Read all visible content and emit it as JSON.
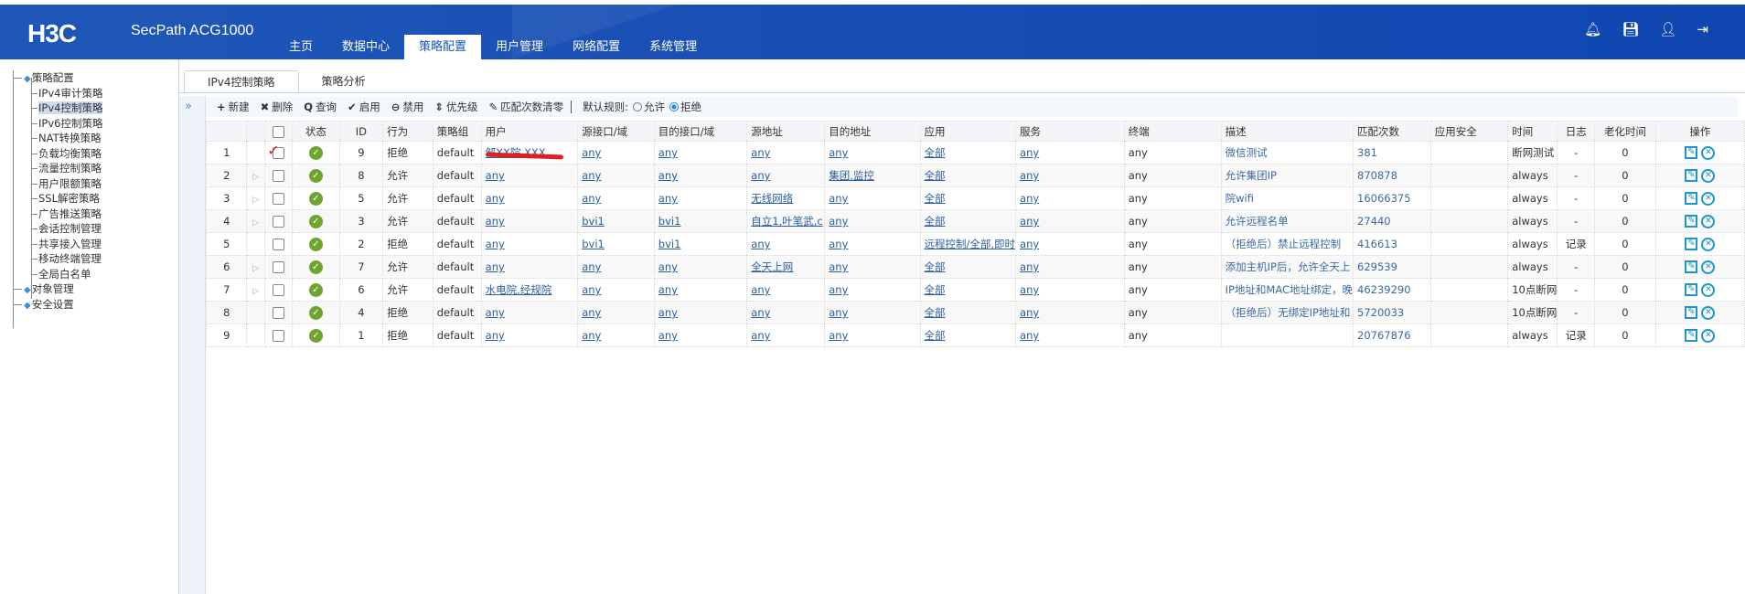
{
  "header": {
    "logo": "H3C",
    "product": "SecPath ACG1000",
    "nav": [
      "主页",
      "数据中心",
      "策略配置",
      "用户管理",
      "网络配置",
      "系统管理"
    ],
    "active_nav": 2,
    "icons": [
      "bell-icon",
      "save-icon",
      "user-icon",
      "logout-icon"
    ]
  },
  "sidebar": {
    "root": "策略配置",
    "items": [
      "IPv4审计策略",
      "IPv4控制策略",
      "IPv6控制策略",
      "NAT转换策略",
      "负载均衡策略",
      "流量控制策略",
      "用户限额策略",
      "SSL解密策略",
      "广告推送策略",
      "会话控制管理",
      "共享接入管理",
      "移动终端管理",
      "全局白名单"
    ],
    "selected": 1,
    "others": [
      "对象管理",
      "安全设置"
    ]
  },
  "tabs": [
    "IPv4控制策略",
    "策略分析"
  ],
  "toolbar": {
    "new": "新建",
    "delete": "删除",
    "query": "查询",
    "enable": "启用",
    "disable": "禁用",
    "priority": "优先级",
    "clear": "匹配次数清零",
    "default_rule_label": "默认规则:",
    "allow": "允许",
    "deny": "拒绝",
    "default_rule": "拒绝"
  },
  "table": {
    "headers": [
      "状态",
      "ID",
      "行为",
      "策略组",
      "用户",
      "源接口/域",
      "目的接口/域",
      "源地址",
      "目的地址",
      "应用",
      "服务",
      "终端",
      "描述",
      "匹配次数",
      "应用安全",
      "时间",
      "日志",
      "老化时间",
      "操作"
    ],
    "rows": [
      {
        "n": "1",
        "exp": false,
        "id": "9",
        "act": "拒绝",
        "grp": "default",
        "user": "邹XX院,XXX",
        "src_if": "any",
        "dst_if": "any",
        "src": "any",
        "dst": "any",
        "app": "全部",
        "svc": "any",
        "term": "any",
        "desc": "微信测试",
        "count": "381",
        "sec": "",
        "time": "断网测试",
        "log": "-",
        "age": "0"
      },
      {
        "n": "2",
        "exp": true,
        "id": "8",
        "act": "允许",
        "grp": "default",
        "user": "any",
        "src_if": "any",
        "dst_if": "any",
        "src": "any",
        "dst": "集团,监控",
        "app": "全部",
        "svc": "any",
        "term": "any",
        "desc": "允许集团IP",
        "count": "870878",
        "sec": "",
        "time": "always",
        "log": "-",
        "age": "0"
      },
      {
        "n": "3",
        "exp": true,
        "id": "5",
        "act": "允许",
        "grp": "default",
        "user": "any",
        "src_if": "any",
        "dst_if": "any",
        "src": "无线网络",
        "dst": "any",
        "app": "全部",
        "svc": "any",
        "term": "any",
        "desc": "院wifi",
        "count": "16066375",
        "sec": "",
        "time": "always",
        "log": "-",
        "age": "0"
      },
      {
        "n": "4",
        "exp": true,
        "id": "3",
        "act": "允许",
        "grp": "default",
        "user": "any",
        "src_if": "bvi1",
        "dst_if": "bvi1",
        "src": "自立1,叶笔武,c",
        "dst": "any",
        "app": "全部",
        "svc": "any",
        "term": "any",
        "desc": "允许远程名单",
        "count": "27440",
        "sec": "",
        "time": "always",
        "log": "-",
        "age": "0"
      },
      {
        "n": "5",
        "exp": false,
        "id": "2",
        "act": "拒绝",
        "grp": "default",
        "user": "any",
        "src_if": "bvi1",
        "dst_if": "bvi1",
        "src": "any",
        "dst": "any",
        "app": "远程控制/全部,即时",
        "svc": "any",
        "term": "any",
        "desc": "（拒绝后）禁止远程控制",
        "count": "416613",
        "sec": "",
        "time": "always",
        "log": "记录",
        "age": "0"
      },
      {
        "n": "6",
        "exp": true,
        "id": "7",
        "act": "允许",
        "grp": "default",
        "user": "any",
        "src_if": "any",
        "dst_if": "any",
        "src": "全天上网",
        "dst": "any",
        "app": "全部",
        "svc": "any",
        "term": "any",
        "desc": "添加主机IP后，允许全天上",
        "count": "629539",
        "sec": "",
        "time": "always",
        "log": "-",
        "age": "0"
      },
      {
        "n": "7",
        "exp": true,
        "id": "6",
        "act": "允许",
        "grp": "default",
        "user": "水电院,经规院",
        "src_if": "any",
        "dst_if": "any",
        "src": "any",
        "dst": "any",
        "app": "全部",
        "svc": "any",
        "term": "any",
        "desc": "IP地址和MAC地址绑定，晚",
        "count": "46239290",
        "sec": "",
        "time": "10点断网",
        "log": "-",
        "age": "0"
      },
      {
        "n": "8",
        "exp": false,
        "id": "4",
        "act": "拒绝",
        "grp": "default",
        "user": "any",
        "src_if": "any",
        "dst_if": "any",
        "src": "any",
        "dst": "any",
        "app": "全部",
        "svc": "any",
        "term": "any",
        "desc": "（拒绝后）无绑定IP地址和",
        "count": "5720033",
        "sec": "",
        "time": "10点断网",
        "log": "-",
        "age": "0"
      },
      {
        "n": "9",
        "exp": false,
        "id": "1",
        "act": "拒绝",
        "grp": "default",
        "user": "any",
        "src_if": "any",
        "dst_if": "any",
        "src": "any",
        "dst": "any",
        "app": "全部",
        "svc": "any",
        "term": "any",
        "desc": "",
        "count": "20767876",
        "sec": "",
        "time": "always",
        "log": "记录",
        "age": "0"
      }
    ]
  },
  "colors": {
    "header": "#1a50b5",
    "ok": "#6ea52f",
    "link": "#2b5f9e",
    "action": "#1e96c8"
  }
}
